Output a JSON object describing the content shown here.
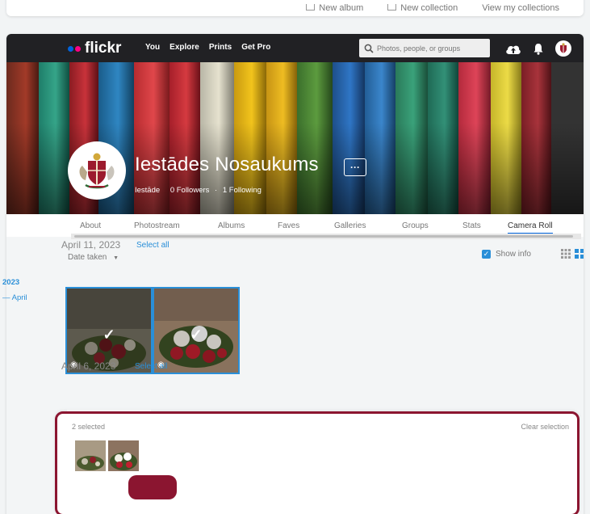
{
  "top_bar": {
    "links": [
      "New album",
      "New collection",
      "View my collections"
    ]
  },
  "nav": {
    "logo": "flickr",
    "links": [
      "You",
      "Explore",
      "Prints",
      "Get Pro"
    ],
    "search_placeholder": "Photos, people, or groups"
  },
  "profile": {
    "name": "Iestādes Nosaukums",
    "more_label": "···",
    "type": "Iestāde",
    "followers": "0 Followers",
    "separator": "·",
    "following": "1 Following"
  },
  "tabs": [
    "About",
    "Photostream",
    "Albums",
    "Faves",
    "Galleries",
    "Groups",
    "Stats",
    "Camera Roll"
  ],
  "active_tab": "Camera Roll",
  "toolbar": {
    "sort_label": "Date taken",
    "show_info_label": "Show info",
    "show_info_checked": true
  },
  "sidebar": {
    "year": "2023",
    "month": "— April"
  },
  "groups": [
    {
      "date": "April 11, 2023",
      "select_all": "Select all"
    },
    {
      "date": "April 6, 2023",
      "select_all": "Select all"
    }
  ],
  "selection": {
    "count": "2 selected",
    "clear": "Clear selection"
  },
  "colors": {
    "nav_bg": "#212124",
    "accent": "#2a8fd8",
    "highlight": "#8b1530"
  }
}
